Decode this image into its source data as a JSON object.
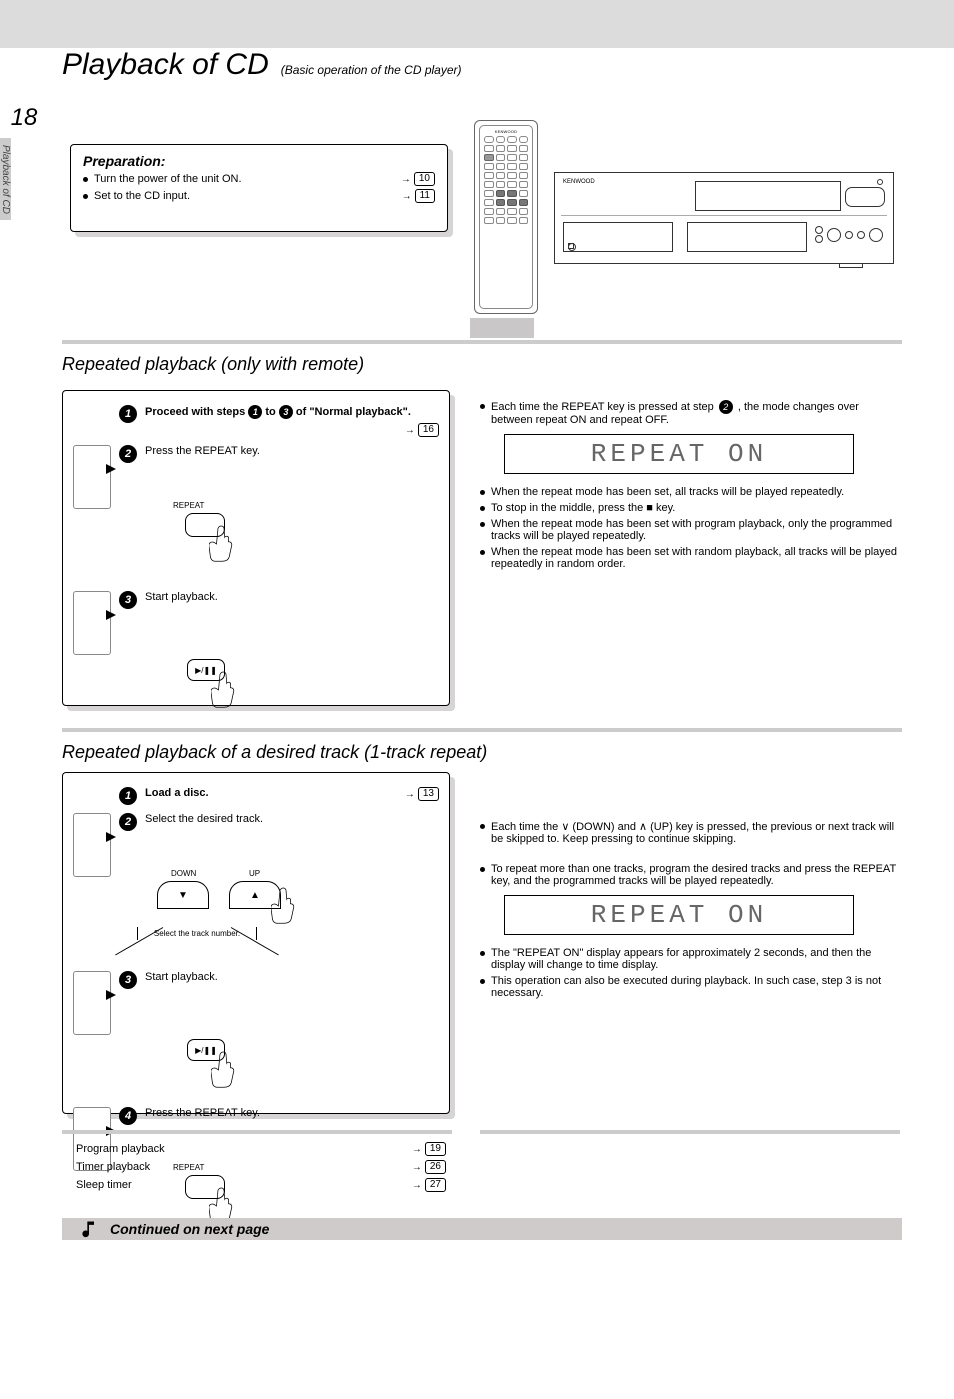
{
  "page_number": "18",
  "side_tab_caption": "Playback of CD",
  "title": {
    "main": "Playback of CD",
    "sub": "(Basic operation of the CD player)"
  },
  "preparation": {
    "heading": "Preparation:",
    "items": [
      {
        "text": "Turn the power of the unit ON.",
        "ref": "10"
      },
      {
        "text": "Set to the CD input.",
        "ref": "11"
      }
    ]
  },
  "diagram": {
    "remote_brand": "KENWOOD",
    "panel_brand": "KENWOOD"
  },
  "section_a": {
    "heading": "Repeated playback (only with remote)",
    "steps": {
      "s1": {
        "prefix": "Proceed with steps",
        "mid": "to",
        "suffix": "of \"Normal playback\".",
        "ref": "16"
      },
      "s2": {
        "bold": "Press the REPEAT key.",
        "label": "REPEAT"
      },
      "s3": {
        "bold": "Start playback."
      }
    },
    "notes": [
      {
        "prefix": "Each time the REPEAT key is pressed at step",
        "suffix": ", the mode changes over between repeat ON and repeat OFF."
      },
      {
        "plain": "When the repeat mode has been set, all tracks will be played repeatedly."
      },
      {
        "plain": "To stop in the middle, press the ■ key."
      },
      {
        "plain": "When the repeat mode has been set with program playback, only the programmed tracks will be played repeatedly."
      },
      {
        "plain": "When the repeat mode has been set with random playback, all tracks will be played repeatedly in random order."
      }
    ],
    "lcd": "REPEAT ON"
  },
  "section_b": {
    "heading": "Repeated playback of a desired track (1-track repeat)",
    "steps": {
      "s1": {
        "bold": "Load a disc.",
        "ref": "13"
      },
      "s2": {
        "bold": "Select the desired track.",
        "callout": "Select the track number.",
        "down": "DOWN",
        "up": "UP"
      },
      "s3": {
        "bold": "Start playback."
      },
      "s4": {
        "bold": "Press the REPEAT key.",
        "label": "REPEAT"
      }
    },
    "notes": [
      {
        "plain": "Each time the ∨ (DOWN) and ∧ (UP) key is pressed, the previous or next track will be skipped to. Keep pressing to continue skipping."
      },
      {
        "plain": "To repeat more than one tracks, program the desired tracks and press the REPEAT key, and the programmed tracks will be played repeatedly."
      },
      {
        "plain": "The \"REPEAT ON\" display appears for approximately 2 seconds, and then the display will change to time display."
      },
      {
        "plain": "This operation can also be executed during playback. In such case, step 3 is not necessary."
      }
    ],
    "lcd": "REPEAT ON"
  },
  "foot_refs": [
    {
      "label": "Program playback",
      "ref": "19"
    },
    {
      "label": "Timer playback",
      "ref": "26"
    },
    {
      "label": "Sleep timer",
      "ref": "27"
    }
  ],
  "continued": "Continued on next page"
}
